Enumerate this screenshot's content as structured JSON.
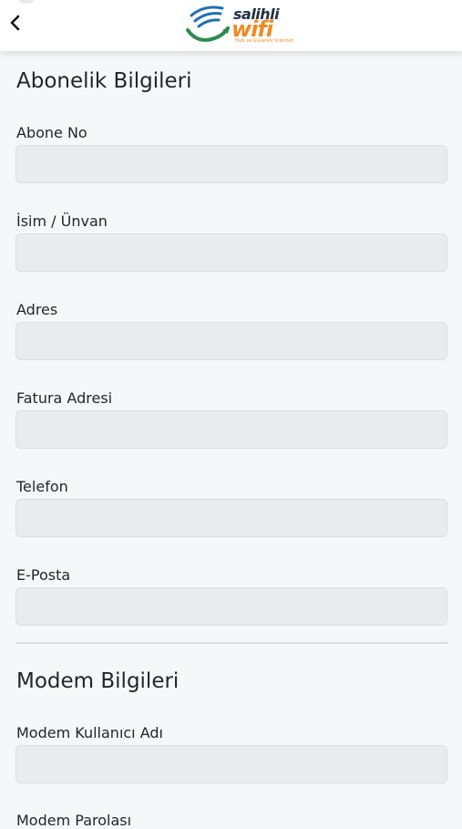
{
  "header": {
    "back_label": "Back",
    "logo": {
      "name": "salihli",
      "wifi": "wifi",
      "slogan": "Hızlı ve Güvenilir İnternet"
    }
  },
  "sections": [
    {
      "title": "Abonelik Bilgileri",
      "fields": [
        {
          "label": "Abone No",
          "value": ""
        },
        {
          "label": "İsim / Ünvan",
          "value": ""
        },
        {
          "label": "Adres",
          "value": ""
        },
        {
          "label": "Fatura Adresi",
          "value": ""
        },
        {
          "label": "Telefon",
          "value": ""
        },
        {
          "label": "E-Posta",
          "value": ""
        }
      ]
    },
    {
      "title": "Modem Bilgileri",
      "fields": [
        {
          "label": "Modem Kullanıcı Adı",
          "value": ""
        },
        {
          "label": "Modem Parolası",
          "value": ""
        }
      ]
    }
  ],
  "colors": {
    "field_bg": "#e9ecef",
    "brand_orange": "#f18a24",
    "brand_green": "#2d8a4e",
    "brand_blue": "#1f6fb5"
  }
}
